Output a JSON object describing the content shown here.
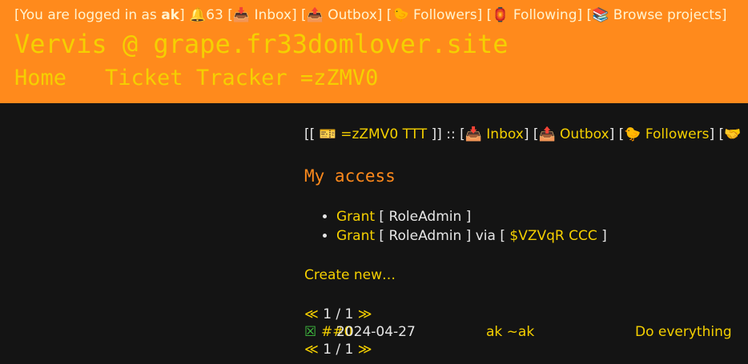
{
  "topbar": {
    "prefix": "[You are logged in as ",
    "user": "ak",
    "suffix": "] ",
    "notifications": "🔔63",
    "links": [
      {
        "label": "📥 Inbox"
      },
      {
        "label": "📤 Outbox"
      },
      {
        "label": "🐤 Followers"
      },
      {
        "label": "🏮 Following"
      },
      {
        "label": "📚 Browse projects"
      }
    ]
  },
  "site": {
    "title": "Vervis @ grape.fr33domlover.site"
  },
  "nav": {
    "home": "Home",
    "tracker": "Ticket Tracker =zZMV0"
  },
  "breadcrumb": {
    "open": "[[ ",
    "tracker_link": "🎫 =zZMV0 TTT",
    "close": " ]] :: ",
    "links": [
      {
        "label": "📥 Inbox"
      },
      {
        "label": "📤 Outbox"
      },
      {
        "label": "🐤 Followers"
      },
      {
        "label": "🤝"
      }
    ]
  },
  "access": {
    "heading": "My access",
    "items": [
      {
        "grant": "Grant",
        "role": " [ RoleAdmin ]",
        "via_text": "",
        "via_link": "",
        "via_close": ""
      },
      {
        "grant": "Grant",
        "role": " [ RoleAdmin ] via [ ",
        "via_text": "",
        "via_link": "$VZVqR CCC",
        "via_close": " ]"
      }
    ]
  },
  "create_new": "Create new…",
  "pager": {
    "prev": "≪",
    "page": " 1 / 1 ",
    "next": "≫"
  },
  "rows": [
    {
      "check": "☒",
      "num": "##0",
      "date": "2024-04-27",
      "author": "ak ~ak",
      "title": "Do everything"
    }
  ]
}
